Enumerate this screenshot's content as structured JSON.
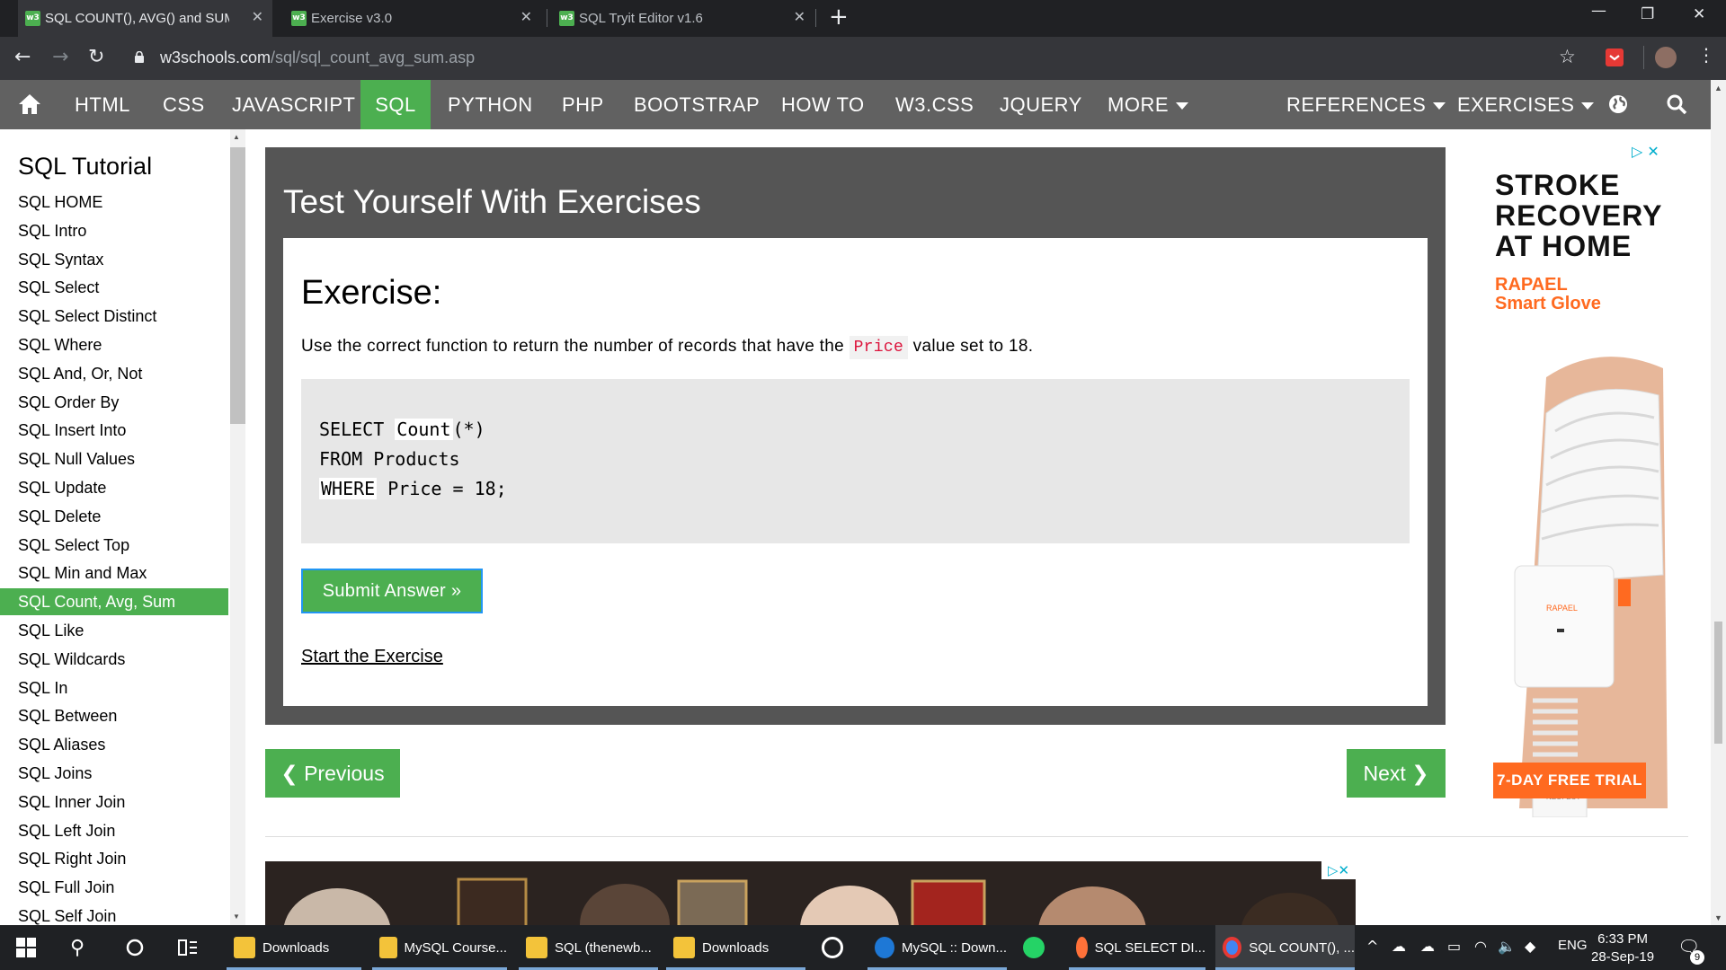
{
  "browser": {
    "tabs": [
      {
        "title": "SQL COUNT(), AVG() and SUM() F",
        "active": true
      },
      {
        "title": "Exercise v3.0",
        "active": false
      },
      {
        "title": "SQL Tryit Editor v1.6",
        "active": false
      }
    ],
    "url_domain": "w3schools.com",
    "url_path": "/sql/sql_count_avg_sum.asp"
  },
  "topnav": {
    "items": [
      "HTML",
      "CSS",
      "JAVASCRIPT",
      "SQL",
      "PYTHON",
      "PHP",
      "BOOTSTRAP",
      "HOW TO",
      "W3.CSS",
      "JQUERY",
      "MORE"
    ],
    "active": "SQL",
    "right_items": [
      "REFERENCES",
      "EXERCISES"
    ]
  },
  "sidebar": {
    "title": "SQL Tutorial",
    "items": [
      "SQL HOME",
      "SQL Intro",
      "SQL Syntax",
      "SQL Select",
      "SQL Select Distinct",
      "SQL Where",
      "SQL And, Or, Not",
      "SQL Order By",
      "SQL Insert Into",
      "SQL Null Values",
      "SQL Update",
      "SQL Delete",
      "SQL Select Top",
      "SQL Min and Max",
      "SQL Count, Avg, Sum",
      "SQL Like",
      "SQL Wildcards",
      "SQL In",
      "SQL Between",
      "SQL Aliases",
      "SQL Joins",
      "SQL Inner Join",
      "SQL Left Join",
      "SQL Right Join",
      "SQL Full Join",
      "SQL Self Join"
    ],
    "active": "SQL Count, Avg, Sum"
  },
  "exercise": {
    "heading": "Test Yourself With Exercises",
    "title": "Exercise:",
    "desc_before": "Use the correct function to return the number of records that have the ",
    "desc_code": "Price",
    "desc_after": " value set to 18.",
    "code": {
      "l1_kw": "SELECT",
      "l1_input": "Count",
      "l1_rest": "(*)",
      "l2": "FROM Products",
      "l3_input": "WHERE",
      "l3_rest": " Price = 18;"
    },
    "submit_label": "Submit Answer »",
    "start_label": "Start the Exercise"
  },
  "pager": {
    "prev": "❮ Previous",
    "next": "Next ❯"
  },
  "ad_right": {
    "headline_lines": [
      "STROKE",
      "RECOVERY",
      "AT HOME"
    ],
    "brand_lines": [
      "RAPAEL",
      "Smart Glove"
    ],
    "device_label": "RAPAEL",
    "device_footer": "NEOFECT",
    "cta": "7-DAY FREE TRIAL"
  },
  "taskbar": {
    "items": [
      "Downloads",
      "MySQL Course...",
      "SQL (thenewb...",
      "Downloads",
      "",
      "MySQL :: Down...",
      "",
      "SQL SELECT DI...",
      "SQL COUNT(), ..."
    ],
    "lang": "ENG",
    "time": "6:33 PM",
    "date": "28-Sep-19",
    "notif_count": "9"
  }
}
